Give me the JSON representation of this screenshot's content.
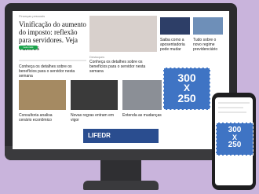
{
  "desktop": {
    "category_top": "Finanças pessoais",
    "headline_main": "Vinificação do aumento do imposto: reflexão para servidores. Veja valores",
    "badge": "Leia mais",
    "category_mid": "Destaques",
    "article_mid": "Conheça os detalhes sobre os benefícios para o servidor nesta semana",
    "sidebar_items": [
      "Saiba como a aposentadoria pode mudar",
      "Tudo sobre o novo regime previdenciário"
    ],
    "row2_items": [
      "Consultoria analisa cenário econômico",
      "Novas regras entram em vigor",
      "Entenda as mudanças"
    ],
    "ad_banner_label": "LIFEDR",
    "ad_block": {
      "line1": "300",
      "line2": "X",
      "line3": "250"
    }
  },
  "phone": {
    "ad_block": {
      "line1": "300",
      "line2": "X",
      "line3": "250"
    }
  },
  "colors": {
    "background": "#c9b4dc",
    "ad": "#3f74c4"
  }
}
